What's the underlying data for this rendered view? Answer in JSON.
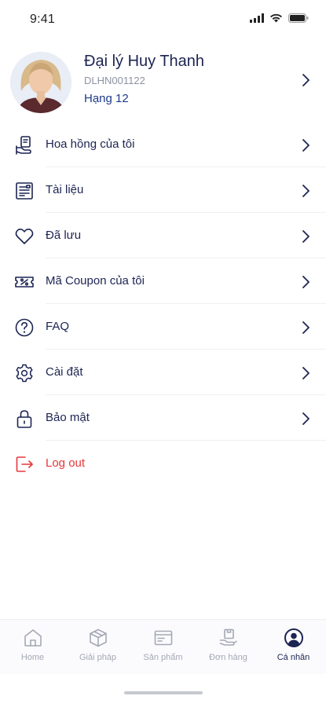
{
  "status_bar": {
    "time": "9:41"
  },
  "profile": {
    "name": "Đại lý Huy Thanh",
    "code": "DLHN001122",
    "rank": "Hạng 12"
  },
  "menu": [
    {
      "label": "Hoa hồng của tôi",
      "icon": "commission-icon"
    },
    {
      "label": "Tài liệu",
      "icon": "document-icon"
    },
    {
      "label": "Đã lưu",
      "icon": "heart-icon"
    },
    {
      "label": "Mã Coupon của tôi",
      "icon": "coupon-icon"
    },
    {
      "label": "FAQ",
      "icon": "question-icon"
    },
    {
      "label": "Cài đặt",
      "icon": "gear-icon"
    },
    {
      "label": "Bảo mật",
      "icon": "lock-icon"
    },
    {
      "label": "Log out",
      "icon": "logout-icon"
    }
  ],
  "bottom_nav": [
    {
      "label": "Home",
      "icon": "home-icon"
    },
    {
      "label": "Giải pháp",
      "icon": "box-icon"
    },
    {
      "label": "Sản phẩm",
      "icon": "product-card-icon"
    },
    {
      "label": "Đơn hàng",
      "icon": "order-icon"
    },
    {
      "label": "Cá nhân",
      "icon": "user-circle-icon",
      "active": true
    }
  ],
  "colors": {
    "primary": "#1c2452",
    "accent_blue": "#1e3a8a",
    "logout_red": "#e5383b",
    "inactive_gray": "#a5a8b5"
  }
}
